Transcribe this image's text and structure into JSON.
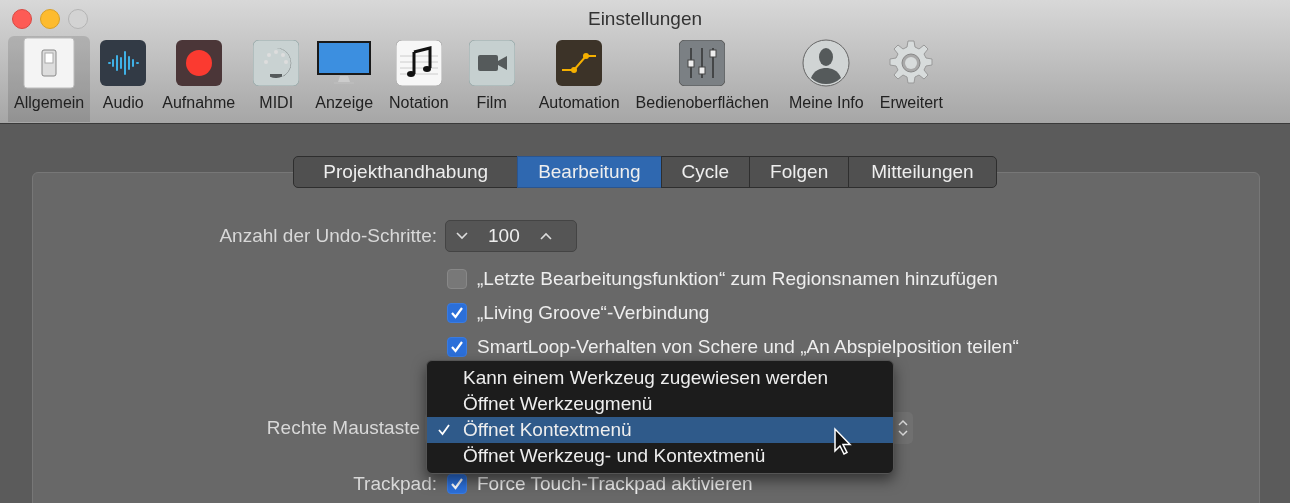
{
  "window": {
    "title": "Einstellungen"
  },
  "toolbar": [
    {
      "label": "Allgemein",
      "kind": "switch",
      "selected": true
    },
    {
      "label": "Audio",
      "kind": "waveform",
      "selected": false
    },
    {
      "label": "Aufnahme",
      "kind": "record",
      "selected": false
    },
    {
      "label": "MIDI",
      "kind": "midi",
      "selected": false
    },
    {
      "label": "Anzeige",
      "kind": "display",
      "selected": false
    },
    {
      "label": "Notation",
      "kind": "notes",
      "selected": false
    },
    {
      "label": "Film",
      "kind": "camera",
      "selected": false
    },
    {
      "label": "Automation",
      "kind": "automation",
      "selected": false
    },
    {
      "label": "Bedienoberflächen",
      "kind": "faders",
      "selected": false
    },
    {
      "label": "Meine Info",
      "kind": "person",
      "selected": false
    },
    {
      "label": "Erweitert",
      "kind": "gear",
      "selected": false
    }
  ],
  "tabs": [
    {
      "label": "Projekthandhabung",
      "selected": false
    },
    {
      "label": "Bearbeitung",
      "selected": true
    },
    {
      "label": "Cycle",
      "selected": false
    },
    {
      "label": "Folgen",
      "selected": false
    },
    {
      "label": "Mitteilungen",
      "selected": false
    }
  ],
  "undo": {
    "label": "Anzahl der Undo-Schritte:",
    "value": "100"
  },
  "options": [
    {
      "label": "„Letzte Bearbeitungsfunktion“ zum Regionsnamen hinzufügen",
      "checked": false
    },
    {
      "label": "„Living Groove“-Verbindung",
      "checked": true
    },
    {
      "label": "SmartLoop-Verhalten von Schere und „An Abspielposition teilen“",
      "checked": true
    }
  ],
  "right_mouse": {
    "label": "Rechte Maustaste"
  },
  "menu": [
    {
      "label": "Kann einem Werkzeug zugewiesen werden",
      "selected": false
    },
    {
      "label": "Öffnet Werkzeugmenü",
      "selected": false
    },
    {
      "label": "Öffnet Kontextmenü",
      "selected": true
    },
    {
      "label": "Öffnet Werkzeug- und Kontextmenü",
      "selected": false
    }
  ],
  "trackpad": {
    "label": "Trackpad:",
    "option": "Force Touch-Trackpad aktivieren",
    "checked": true
  }
}
